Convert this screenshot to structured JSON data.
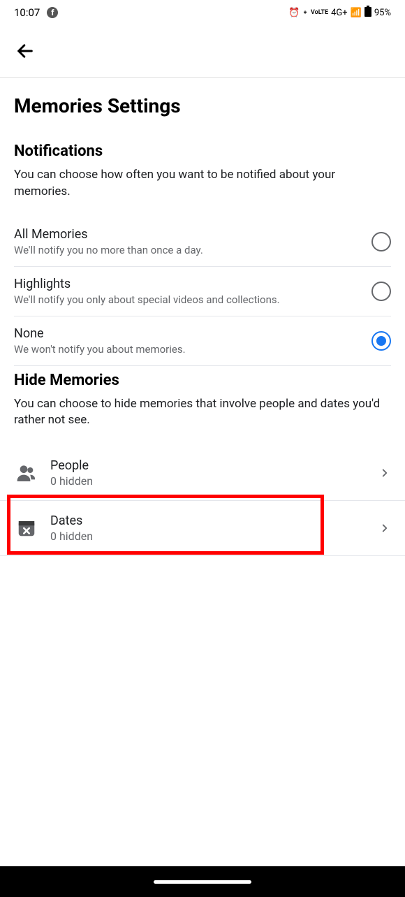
{
  "status": {
    "time": "10:07",
    "network": "4G+",
    "battery": "95%"
  },
  "page": {
    "title": "Memories Settings"
  },
  "notifications": {
    "heading": "Notifications",
    "desc": "You can choose how often you want to be notified about your memories.",
    "options": [
      {
        "title": "All Memories",
        "sub": "We'll notify you no more than once a day.",
        "selected": false
      },
      {
        "title": "Highlights",
        "sub": "We'll notify you only about special videos and collections.",
        "selected": false
      },
      {
        "title": "None",
        "sub": "We won't notify you about memories.",
        "selected": true
      }
    ]
  },
  "hide": {
    "heading": "Hide Memories",
    "desc": "You can choose to hide memories that involve people and dates you'd rather not see.",
    "items": [
      {
        "title": "People",
        "sub": "0 hidden"
      },
      {
        "title": "Dates",
        "sub": "0 hidden"
      }
    ]
  }
}
